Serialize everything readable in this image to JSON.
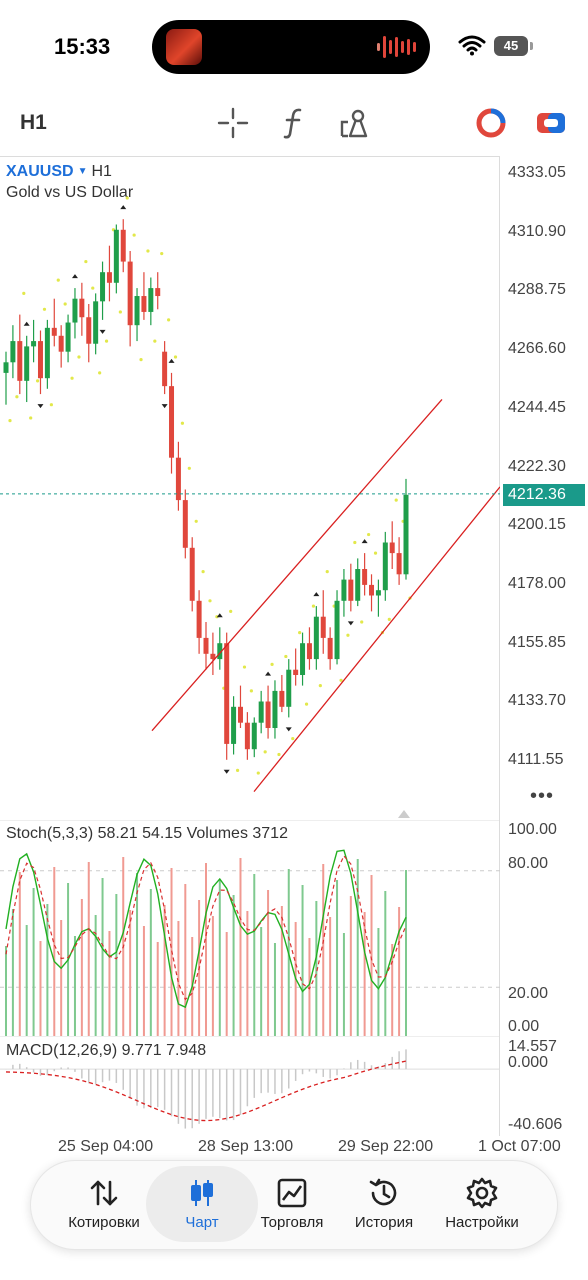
{
  "status": {
    "time": "15:33",
    "battery": "45"
  },
  "toolbar": {
    "timeframe": "H1",
    "tools": [
      "crosshair-icon",
      "function-icon",
      "objects-icon",
      "color-scheme-icon",
      "trade-icon"
    ]
  },
  "chart": {
    "symbol": "XAUUSD",
    "symbol_timeframe": "H1",
    "description": "Gold vs US Dollar",
    "price_scale": [
      "4333.05",
      "4310.90",
      "4288.75",
      "4266.60",
      "4244.45",
      "4222.30",
      "4200.15",
      "4178.00",
      "4155.85",
      "4133.70",
      "4111.55"
    ],
    "current_price": "4212.36",
    "more_label": "•••",
    "time_axis": [
      "25 Sep 04:00",
      "28 Sep 13:00",
      "29 Sep 22:00",
      "1 Oct 07:00"
    ],
    "colors": {
      "bull": "#1f9e4a",
      "bear": "#e0473c",
      "sar": "#e2e84a",
      "channel": "#d92020",
      "price_line": "#1a9a8a"
    }
  },
  "stoch": {
    "title": "Stoch(5,3,3) 58.21 54.15 Volumes 3712",
    "levels": [
      "100.00",
      "80.00",
      "20.00",
      "0.00"
    ]
  },
  "macd": {
    "title": "MACD(12,26,9) 9.771 7.948",
    "levels": [
      "14.557",
      "0.000",
      "-40.606"
    ]
  },
  "nav": {
    "items": [
      {
        "label": "Котировки",
        "icon": "quotes-icon"
      },
      {
        "label": "Чарт",
        "icon": "chart-icon"
      },
      {
        "label": "Торговля",
        "icon": "trade-chart-icon"
      },
      {
        "label": "История",
        "icon": "history-icon"
      },
      {
        "label": "Настройки",
        "icon": "settings-icon"
      }
    ],
    "active": "Чарт"
  },
  "chart_data": {
    "type": "candlestick",
    "symbol": "XAUUSD",
    "timeframe": "H1",
    "ylim": [
      4100,
      4336
    ],
    "x_ticks": [
      "25 Sep 04:00",
      "28 Sep 13:00",
      "29 Sep 22:00",
      "1 Oct 07:00"
    ],
    "last_price": 4212.36,
    "candles_ohlc": [
      [
        4258,
        4266,
        4246,
        4262
      ],
      [
        4262,
        4276,
        4256,
        4270
      ],
      [
        4270,
        4280,
        4250,
        4255
      ],
      [
        4255,
        4272,
        4247,
        4268
      ],
      [
        4268,
        4278,
        4262,
        4270
      ],
      [
        4270,
        4274,
        4250,
        4256
      ],
      [
        4256,
        4278,
        4252,
        4275
      ],
      [
        4275,
        4286,
        4268,
        4272
      ],
      [
        4272,
        4276,
        4260,
        4266
      ],
      [
        4266,
        4280,
        4262,
        4277
      ],
      [
        4277,
        4290,
        4271,
        4286
      ],
      [
        4286,
        4292,
        4272,
        4279
      ],
      [
        4279,
        4284,
        4262,
        4269
      ],
      [
        4269,
        4288,
        4265,
        4285
      ],
      [
        4285,
        4300,
        4278,
        4296
      ],
      [
        4296,
        4306,
        4285,
        4292
      ],
      [
        4292,
        4314,
        4288,
        4312
      ],
      [
        4312,
        4316,
        4296,
        4300
      ],
      [
        4300,
        4304,
        4268,
        4276
      ],
      [
        4276,
        4290,
        4270,
        4287
      ],
      [
        4287,
        4296,
        4278,
        4281
      ],
      [
        4281,
        4294,
        4276,
        4290
      ],
      [
        4290,
        4296,
        4282,
        4287
      ],
      [
        4266,
        4270,
        4250,
        4253
      ],
      [
        4253,
        4258,
        4220,
        4226
      ],
      [
        4226,
        4232,
        4206,
        4210
      ],
      [
        4210,
        4214,
        4188,
        4192
      ],
      [
        4192,
        4196,
        4168,
        4172
      ],
      [
        4172,
        4176,
        4152,
        4158
      ],
      [
        4158,
        4164,
        4146,
        4152
      ],
      [
        4152,
        4160,
        4144,
        4150
      ],
      [
        4150,
        4162,
        4146,
        4156
      ],
      [
        4156,
        4160,
        4112,
        4118
      ],
      [
        4118,
        4136,
        4114,
        4132
      ],
      [
        4132,
        4140,
        4124,
        4126
      ],
      [
        4126,
        4130,
        4112,
        4116
      ],
      [
        4116,
        4128,
        4113,
        4126
      ],
      [
        4126,
        4138,
        4122,
        4134
      ],
      [
        4134,
        4140,
        4120,
        4124
      ],
      [
        4124,
        4142,
        4120,
        4138
      ],
      [
        4138,
        4144,
        4130,
        4132
      ],
      [
        4132,
        4150,
        4128,
        4146
      ],
      [
        4146,
        4154,
        4140,
        4144
      ],
      [
        4144,
        4160,
        4140,
        4156
      ],
      [
        4156,
        4162,
        4146,
        4150
      ],
      [
        4150,
        4170,
        4146,
        4166
      ],
      [
        4166,
        4176,
        4152,
        4158
      ],
      [
        4158,
        4162,
        4146,
        4150
      ],
      [
        4150,
        4176,
        4148,
        4172
      ],
      [
        4172,
        4184,
        4166,
        4180
      ],
      [
        4180,
        4186,
        4168,
        4172
      ],
      [
        4172,
        4188,
        4170,
        4184
      ],
      [
        4184,
        4190,
        4174,
        4178
      ],
      [
        4178,
        4182,
        4168,
        4174
      ],
      [
        4174,
        4180,
        4166,
        4176
      ],
      [
        4176,
        4198,
        4172,
        4194
      ],
      [
        4194,
        4202,
        4184,
        4190
      ],
      [
        4190,
        4196,
        4178,
        4182
      ],
      [
        4182,
        4218,
        4180,
        4212
      ]
    ],
    "channel": {
      "upper": [
        [
          4123,
          4248
        ]
      ],
      "lower": [
        [
          4100,
          4215
        ]
      ]
    },
    "stoch": {
      "k": 58.21,
      "d": 54.15,
      "volumes": 3712,
      "levels": [
        100,
        80,
        20,
        0
      ]
    },
    "macd": {
      "main": 9.771,
      "signal": 7.948,
      "range": [
        -40.606,
        14.557
      ]
    }
  }
}
